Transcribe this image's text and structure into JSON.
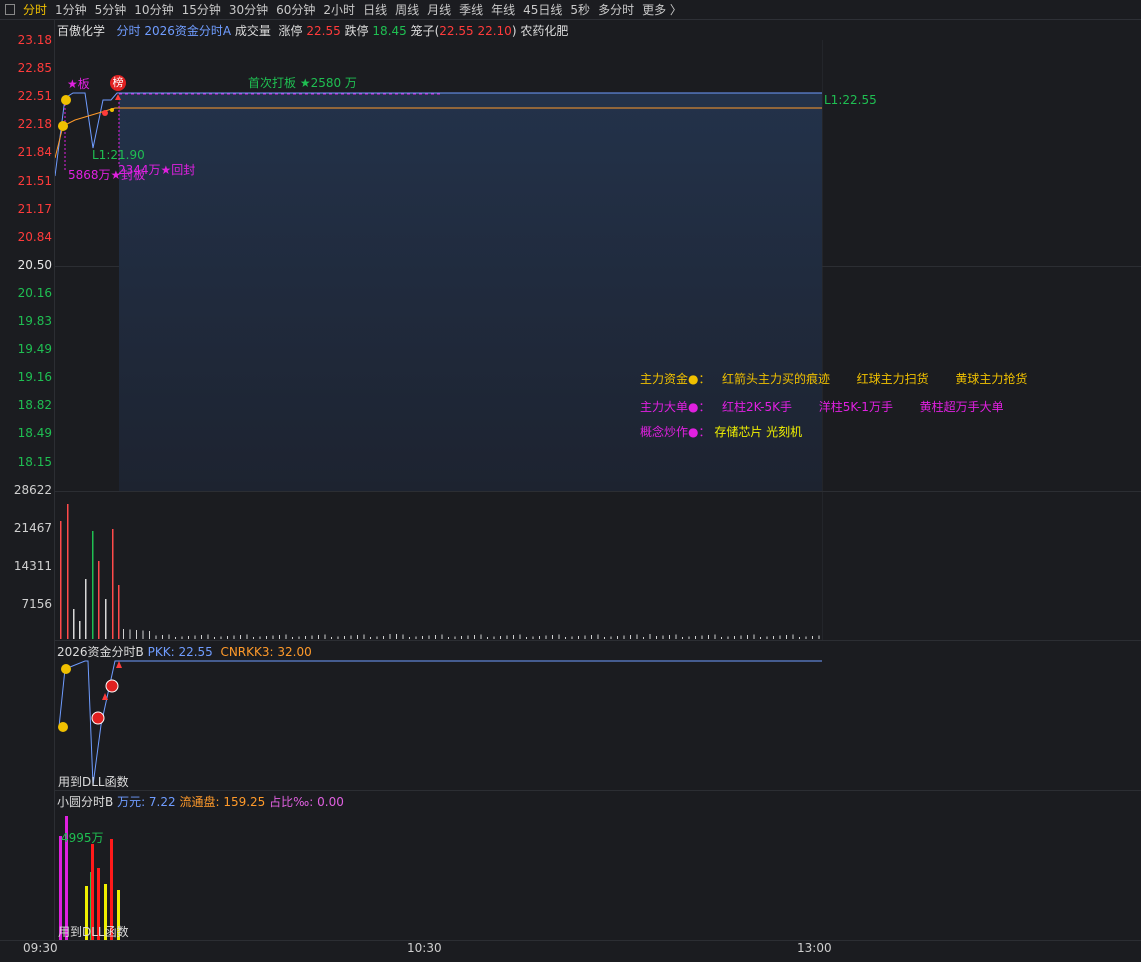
{
  "toolbar": {
    "items": [
      "分时",
      "1分钟",
      "5分钟",
      "10分钟",
      "15分钟",
      "30分钟",
      "60分钟",
      "2小时",
      "日线",
      "周线",
      "月线",
      "季线",
      "年线",
      "45日线",
      "5秒",
      "多分时",
      "更多 〉"
    ],
    "active_index": 0
  },
  "main_header": {
    "stock_name": "百傲化学",
    "indicator": "分时",
    "formula": "2026资金分时A",
    "volume_label": "成交量",
    "limit_up_label": "涨停",
    "limit_up_value": "22.55",
    "limit_down_label": "跌停",
    "limit_down_value": "18.45",
    "cage_label": "笼子(",
    "cage_value": "22.55 22.10",
    "cage_close": ")",
    "sector": "农药化肥"
  },
  "price_axis": [
    {
      "v": "23.18",
      "c": "red"
    },
    {
      "v": "22.85",
      "c": "red"
    },
    {
      "v": "22.51",
      "c": "red"
    },
    {
      "v": "22.18",
      "c": "red"
    },
    {
      "v": "21.84",
      "c": "red"
    },
    {
      "v": "21.51",
      "c": "red"
    },
    {
      "v": "21.17",
      "c": "red"
    },
    {
      "v": "20.84",
      "c": "red"
    },
    {
      "v": "20.50",
      "c": "white"
    },
    {
      "v": "20.16",
      "c": "green"
    },
    {
      "v": "19.83",
      "c": "green"
    },
    {
      "v": "19.49",
      "c": "green"
    },
    {
      "v": "19.16",
      "c": "green"
    },
    {
      "v": "18.82",
      "c": "green"
    },
    {
      "v": "18.49",
      "c": "green"
    },
    {
      "v": "18.15",
      "c": "green"
    }
  ],
  "volume_axis": [
    "28622",
    "21467",
    "14311",
    "7156"
  ],
  "annotations": {
    "star_board": "★板",
    "tag_circle": "榜",
    "first_board": "首次打板 ★2580 万",
    "l1": "L1:21.90",
    "seal1": "5868万★封板",
    "seal2": "2344万★回封",
    "right_label": "L1:22.55"
  },
  "legend": {
    "row1": {
      "title": "主力资金●：",
      "a": "红箭头主力买的痕迹",
      "b": "红球主力扫货",
      "c": "黄球主力抢货"
    },
    "row2": {
      "title": "主力大单●：",
      "a": "红柱2K-5K手",
      "b": "洋柱5K-1万手",
      "c": "黄柱超万手大单"
    },
    "row3": {
      "title": "概念炒作●：",
      "a": "存储芯片 光刻机"
    }
  },
  "pane_b": {
    "title": "2026资金分时B",
    "pkk": "PKK: 22.55",
    "cnrkk": "CNRKK3: 32.00",
    "footer": "用到DLL函数"
  },
  "pane_c": {
    "title": "小圆分时B",
    "wan": "万元: 7.22",
    "float": "流通盘: 159.25",
    "ratio": "占比‰: 0.00",
    "bar_label": "4995万",
    "footer": "用到DLL函数"
  },
  "time_axis": [
    "09:30",
    "10:30",
    "13:00"
  ],
  "colors": {
    "bg": "#1b1c20",
    "red": "#ff3b3b",
    "green": "#1fbf52",
    "yellow": "#f0c000",
    "magenta": "#e020e0",
    "blue": "#6f9cff",
    "orange": "#ff9a2a"
  }
}
